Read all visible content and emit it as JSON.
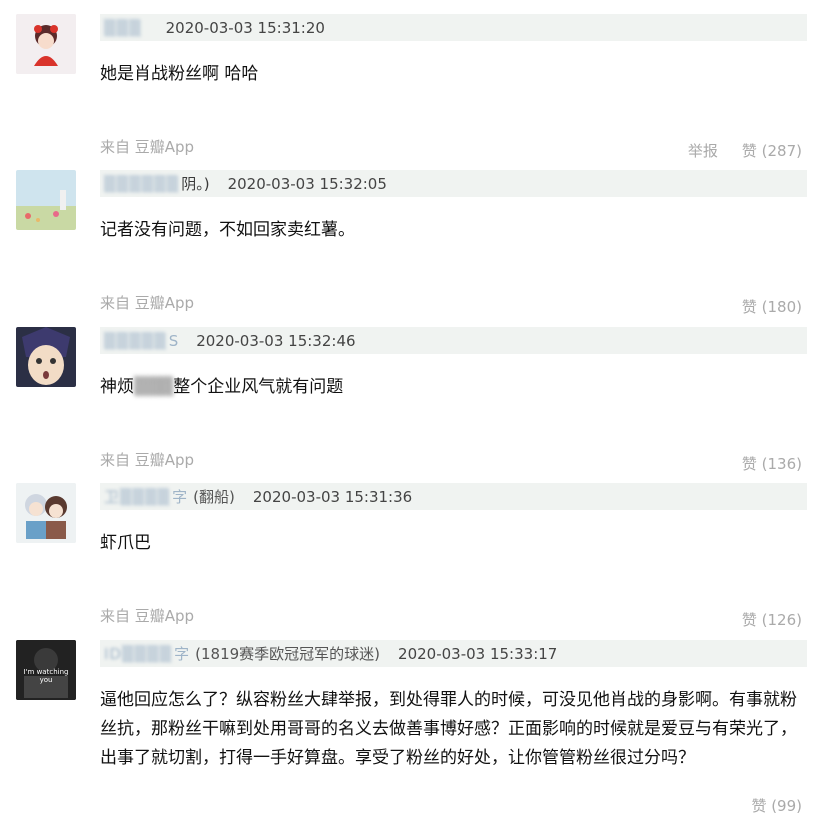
{
  "comments": [
    {
      "username": "▒▒▒",
      "username_tail": "",
      "tag": "",
      "time": "2020-03-03 15:31:20",
      "text": "她是肖战粉丝啊 哈哈",
      "source": "来自 豆瓣App",
      "report": "举报",
      "likes": "赞 (287)"
    },
    {
      "username": "▒▒▒▒▒▒",
      "username_tail": "阴。)",
      "tag": "",
      "time": "2020-03-03 15:32:05",
      "text": "记者没有问题，不如回家卖红薯。",
      "source": "来自 豆瓣App",
      "likes": "赞 (180)"
    },
    {
      "username": "▒▒▒▒▒",
      "username_tail": "S",
      "tag": "",
      "time": "2020-03-03 15:32:46",
      "text_pre": "神烦",
      "text_blur": "▒▒▒",
      "text_post": "整个企业风气就有问题",
      "source": "来自 豆瓣App",
      "likes": "赞 (136)"
    },
    {
      "username": "卫▒▒▒▒",
      "username_tail": "字",
      "tag": "(翻船)",
      "time": "2020-03-03 15:31:36",
      "text": "虾爪巴",
      "source": "来自 豆瓣App",
      "likes": "赞 (126)"
    },
    {
      "username": "ID▒▒▒▒",
      "username_tail": "字",
      "tag": "(1819赛季欧冠冠军的球迷)",
      "time": "2020-03-03 15:33:17",
      "text": "逼他回应怎么了？纵容粉丝大肆举报，到处得罪人的时候，可没见他肖战的身影啊。有事就粉丝抗，那粉丝干嘛到处用哥哥的名义去做善事博好感？正面影响的时候就是爱豆与有荣光了，出事了就切割，打得一手好算盘。享受了粉丝的好处，让你管管粉丝很过分吗？",
      "source": "",
      "likes": "赞 (99)",
      "avatar_text": "I'm watching you"
    }
  ]
}
